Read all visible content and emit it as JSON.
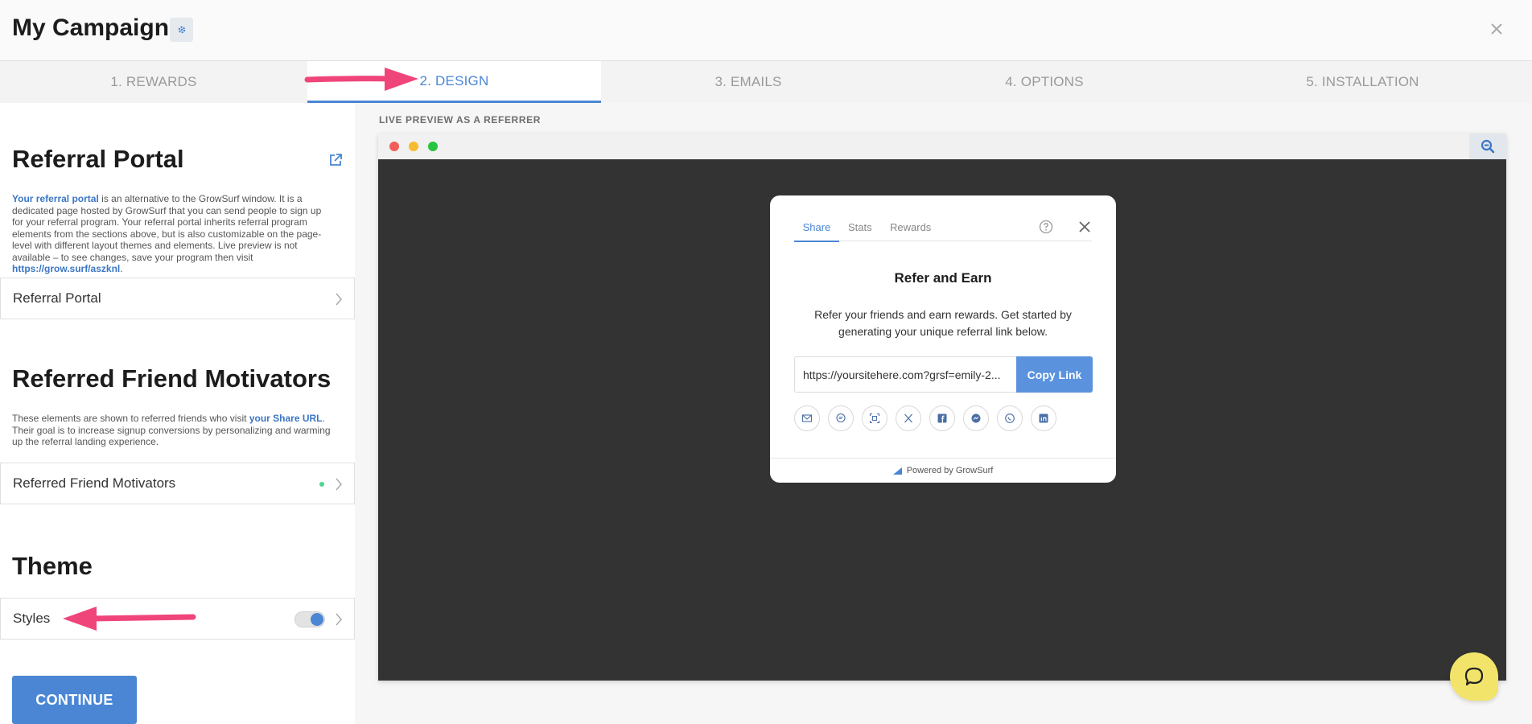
{
  "header": {
    "title": "My Campaign",
    "icons": {
      "settings": "gear-icon",
      "close": "close-icon"
    }
  },
  "tabs": [
    {
      "label": "1. REWARDS",
      "active": false
    },
    {
      "label": "2. DESIGN",
      "active": true
    },
    {
      "label": "3. EMAILS",
      "active": false
    },
    {
      "label": "4. OPTIONS",
      "active": false
    },
    {
      "label": "5. INSTALLATION",
      "active": false
    }
  ],
  "left": {
    "referral_portal": {
      "title": "Referral Portal",
      "desc_link": "Your referral portal",
      "desc_text": " is an alternative to the GrowSurf window. It is a dedicated page hosted by GrowSurf that you can send people to sign up for your referral program. Your referral portal inherits referral program elements from the sections above, but is also customizable on the page-level with different layout themes and elements. Live preview is not available – to see changes, save your program then visit ",
      "desc_url": "https://grow.surf/aszknl",
      "desc_end": ".",
      "row_label": "Referral Portal"
    },
    "motivators": {
      "title": "Referred Friend Motivators",
      "desc_text": "These elements are shown to referred friends who visit ",
      "desc_link": "your Share URL",
      "desc_end": ". Their goal is to increase signup conversions by personalizing and warming up the referral landing experience.",
      "row_label": "Referred Friend Motivators"
    },
    "theme": {
      "title": "Theme",
      "row_label": "Styles",
      "toggle_on": true
    },
    "continue_label": "CONTINUE"
  },
  "preview": {
    "label": "LIVE PREVIEW AS A REFERRER",
    "modal": {
      "tabs": [
        "Share",
        "Stats",
        "Rewards"
      ],
      "title": "Refer and Earn",
      "desc_line1": "Refer your friends and earn rewards. Get started by",
      "desc_line2": "generating your unique referral link below.",
      "link_value": "https://yoursitehere.com?grsf=emily-2...",
      "copy_label": "Copy Link",
      "social_icons": [
        "email-icon",
        "sms-icon",
        "qr-icon",
        "x-icon",
        "facebook-icon",
        "messenger-icon",
        "whatsapp-icon",
        "linkedin-icon"
      ],
      "footer": "Powered by GrowSurf"
    }
  },
  "colors": {
    "accent": "#4a86d4",
    "annotation_arrow": "#f0457a",
    "chat_bubble": "#f2e36a",
    "preview_bg": "#333333"
  }
}
